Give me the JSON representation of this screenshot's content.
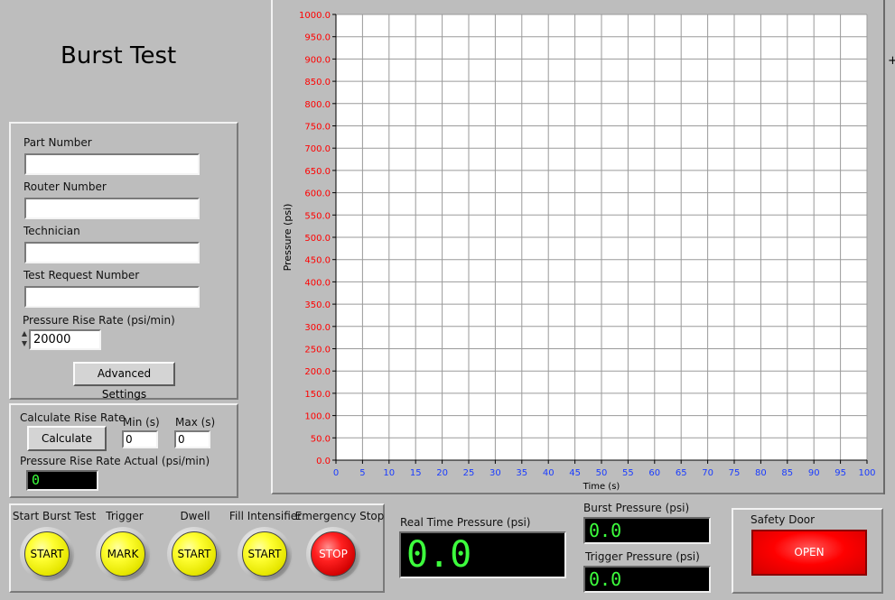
{
  "title": "Burst Test",
  "form": {
    "part_number": {
      "label": "Part Number",
      "value": ""
    },
    "router_number": {
      "label": "Router Number",
      "value": ""
    },
    "technician": {
      "label": "Technician",
      "value": ""
    },
    "test_request_number": {
      "label": "Test Request Number",
      "value": ""
    },
    "pressure_rise_rate": {
      "label": "Pressure Rise Rate (psi/min)",
      "value": "20000"
    },
    "advanced_settings_label": "Advanced Settings"
  },
  "calc": {
    "title": "Calculate Rise Rate",
    "button_label": "Calculate",
    "min_label": "Min (s)",
    "min_value": "0",
    "max_label": "Max (s)",
    "max_value": "0",
    "actual_label": "Pressure Rise Rate Actual (psi/min)",
    "actual_value": "0"
  },
  "buttons": [
    {
      "label": "Start Burst Test",
      "text": "START",
      "color": "yellow"
    },
    {
      "label": "Trigger",
      "text": "MARK",
      "color": "yellow"
    },
    {
      "label": "Dwell",
      "text": "START",
      "color": "yellow"
    },
    {
      "label": "Fill Intensifier",
      "text": "START",
      "color": "yellow"
    },
    {
      "label": "Emergency Stop",
      "text": "STOP",
      "color": "red"
    }
  ],
  "realtime": {
    "label": "Real Time Pressure (psi)",
    "value": "0.0"
  },
  "burst": {
    "label": "Burst Pressure (psi)",
    "value": "0.0"
  },
  "trigger_pressure": {
    "label": "Trigger Pressure (psi)",
    "value": "0.0"
  },
  "safety_door": {
    "label": "Safety Door",
    "state": "OPEN",
    "color": "#ff0000"
  },
  "chart_data": {
    "type": "line",
    "title": "",
    "xlabel": "Time (s)",
    "ylabel": "Pressure (psi)",
    "xlim": [
      0,
      100
    ],
    "ylim": [
      0,
      1000
    ],
    "x_ticks": [
      "0",
      "5",
      "10",
      "15",
      "20",
      "25",
      "30",
      "35",
      "40",
      "45",
      "50",
      "55",
      "60",
      "65",
      "70",
      "75",
      "80",
      "85",
      "90",
      "95",
      "100"
    ],
    "y_ticks": [
      "0.0",
      "50.0",
      "100.0",
      "150.0",
      "200.0",
      "250.0",
      "300.0",
      "350.0",
      "400.0",
      "450.0",
      "500.0",
      "550.0",
      "600.0",
      "650.0",
      "700.0",
      "750.0",
      "800.0",
      "850.0",
      "900.0",
      "950.0",
      "1000.0"
    ],
    "grid": true,
    "series": [],
    "colors": {
      "x_tick": "#1a3cff",
      "y_tick": "#ff0000",
      "grid": "#9a9a9a",
      "plot_bg": "#ffffff"
    }
  }
}
